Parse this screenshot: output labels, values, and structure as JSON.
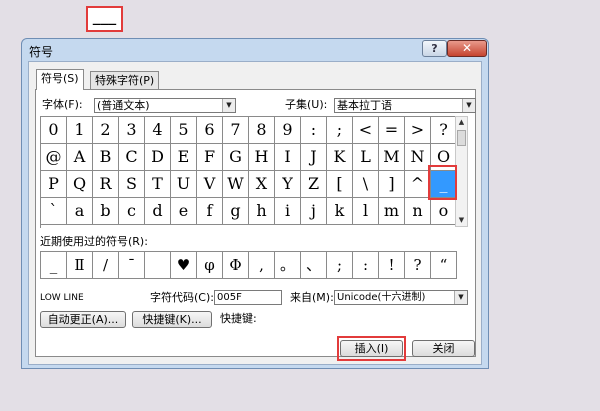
{
  "document": {
    "sample_text": "___"
  },
  "dialog": {
    "title": "符号",
    "help_label": "?",
    "close_label": "✕",
    "tabs": [
      {
        "label": "符号(S)"
      },
      {
        "label": "特殊字符(P)"
      }
    ],
    "font_label": "字体(F):",
    "font_value": "(普通文本)",
    "subset_label": "子集(U):",
    "subset_value": "基本拉丁语",
    "symbol_rows": [
      [
        "0",
        "1",
        "2",
        "3",
        "4",
        "5",
        "6",
        "7",
        "8",
        "9",
        ":",
        ";",
        "<",
        "=",
        ">",
        "?"
      ],
      [
        "@",
        "A",
        "B",
        "C",
        "D",
        "E",
        "F",
        "G",
        "H",
        "I",
        "J",
        "K",
        "L",
        "M",
        "N",
        "O"
      ],
      [
        "P",
        "Q",
        "R",
        "S",
        "T",
        "U",
        "V",
        "W",
        "X",
        "Y",
        "Z",
        "[",
        "\\",
        "]",
        "^",
        "_"
      ],
      [
        "`",
        "a",
        "b",
        "c",
        "d",
        "e",
        "f",
        "g",
        "h",
        "i",
        "j",
        "k",
        "l",
        "m",
        "n",
        "o"
      ]
    ],
    "selected_symbol": "_",
    "recent_label": "近期使用过的符号(R):",
    "recent_symbols": [
      "_",
      "Ⅱ",
      "/",
      "¯",
      "",
      "♥",
      "φ",
      "Φ",
      ",",
      "。",
      "、",
      ";",
      ":",
      "!",
      "?",
      "“"
    ],
    "char_name": "LOW LINE",
    "char_code_label": "字符代码(C):",
    "char_code_value": "005F",
    "from_label": "来自(M):",
    "from_value": "Unicode(十六进制)",
    "autocorrect_label": "自动更正(A)...",
    "shortcut_key_label": "快捷键(K)...",
    "shortcut_label": "快捷键:",
    "insert_label": "插入(I)",
    "close_button_label": "关闭",
    "accent_color": "#3399ff",
    "highlight_color": "#e23b3b"
  }
}
